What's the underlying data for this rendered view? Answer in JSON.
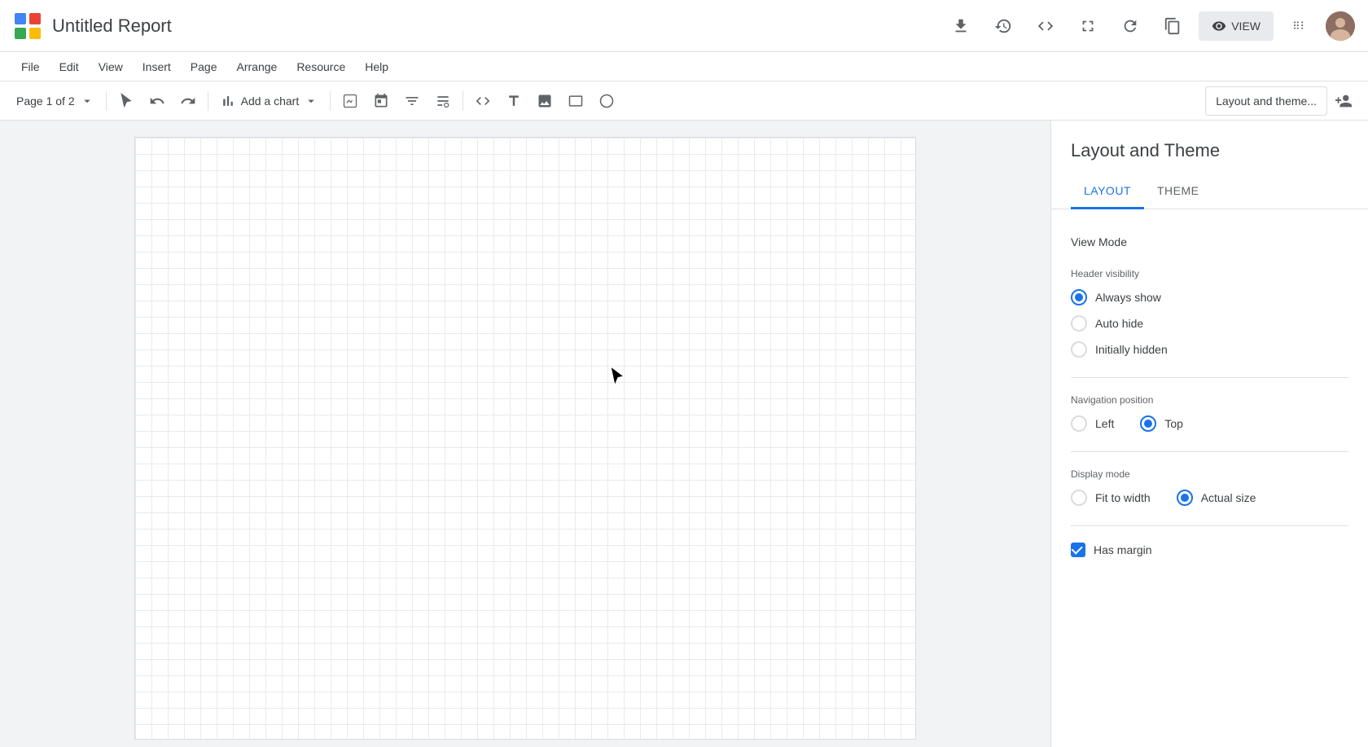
{
  "app": {
    "title": "Untitled Report",
    "logo_colors": [
      "#4285f4",
      "#ea4335",
      "#fbbc04",
      "#34a853"
    ]
  },
  "top_bar": {
    "download_icon": "⬇",
    "history_icon": "🕐",
    "code_icon": "<>",
    "fullscreen_icon": "⛶",
    "refresh_icon": "↺",
    "copy_icon": "⧉",
    "view_label": "VIEW",
    "apps_icon": "⊞"
  },
  "menu": {
    "items": [
      "File",
      "Edit",
      "View",
      "Insert",
      "Page",
      "Arrange",
      "Resource",
      "Help"
    ]
  },
  "toolbar": {
    "page_label": "Page 1 of 2",
    "add_chart_label": "Add a chart",
    "layout_theme_placeholder": "Layout and theme...",
    "add_collaborator_icon": "+👤"
  },
  "right_panel": {
    "title": "Layout and Theme",
    "tabs": [
      {
        "label": "LAYOUT",
        "active": true
      },
      {
        "label": "THEME",
        "active": false
      }
    ],
    "view_mode_label": "View Mode",
    "header_visibility_label": "Header visibility",
    "header_options": [
      {
        "label": "Always show",
        "checked": true
      },
      {
        "label": "Auto hide",
        "checked": false
      },
      {
        "label": "Initially hidden",
        "checked": false
      }
    ],
    "navigation_position_label": "Navigation position",
    "nav_options": [
      {
        "label": "Left",
        "checked": false
      },
      {
        "label": "Top",
        "checked": true
      }
    ],
    "display_mode_label": "Display mode",
    "display_options": [
      {
        "label": "Fit to width",
        "checked": false
      },
      {
        "label": "Actual size",
        "checked": true
      }
    ],
    "has_margin_label": "Has margin",
    "has_margin_checked": true
  }
}
